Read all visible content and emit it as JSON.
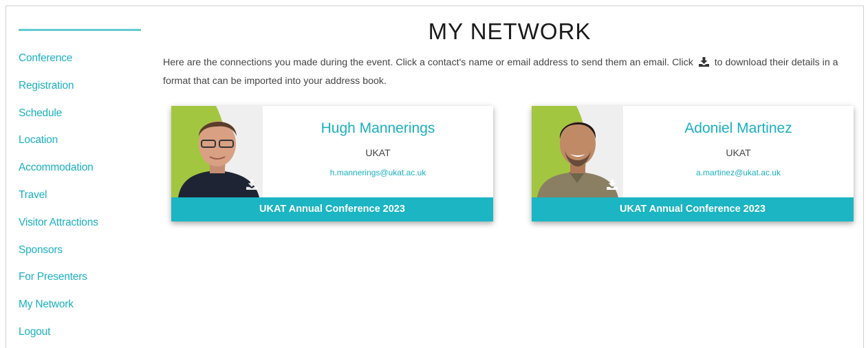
{
  "sidebar": {
    "items": [
      {
        "label": "Conference"
      },
      {
        "label": "Registration"
      },
      {
        "label": "Schedule"
      },
      {
        "label": "Location"
      },
      {
        "label": "Accommodation"
      },
      {
        "label": "Travel"
      },
      {
        "label": "Visitor Attractions"
      },
      {
        "label": "Sponsors"
      },
      {
        "label": "For Presenters"
      },
      {
        "label": "My Network"
      },
      {
        "label": "Logout"
      }
    ]
  },
  "main": {
    "title": "MY NETWORK",
    "intro_part1": "Here are the connections you made during the event. Click a contact's name or email address to send them an email. Click",
    "intro_part2": "to download their details in a format that can be imported into your address book."
  },
  "contacts": [
    {
      "name": "Hugh Mannerings",
      "organisation": "UKAT",
      "email": "h.mannerings@ukat.ac.uk",
      "event": "UKAT Annual Conference 2023"
    },
    {
      "name": "Adoniel Martinez",
      "organisation": "UKAT",
      "email": "a.martinez@ukat.ac.uk",
      "event": "UKAT Annual Conference 2023"
    }
  ],
  "icons": {
    "download": "download-icon"
  },
  "colors": {
    "accent": "#1ab0c0",
    "event_bar": "#1bb5c3",
    "photo_accent": "#a3c640"
  }
}
